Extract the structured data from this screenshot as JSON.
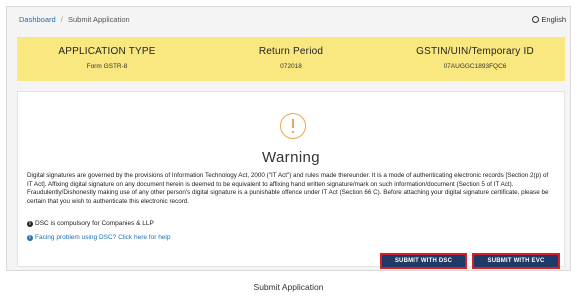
{
  "breadcrumb": {
    "home": "Dashboard",
    "separator": "/",
    "current": "Submit Application"
  },
  "language": {
    "label": "English",
    "icon": "globe-icon"
  },
  "info": {
    "application_type": {
      "label": "APPLICATION TYPE",
      "value": "Form GSTR-8"
    },
    "return_period": {
      "label": "Return Period",
      "value": "072018"
    },
    "gstin": {
      "label": "GSTIN/UIN/Temporary ID",
      "value": "07AUGGC1893FQC6"
    }
  },
  "warning": {
    "icon": "exclamation-circle-icon",
    "title": "Warning",
    "body": "Digital signatures are governed by the provisions of Information Technology Act, 2000 (\"IT Act\") and rules made thereunder. It is a mode of authenticating electronic records [Section 2(p) of IT Act]. Affixing digital signature on any document herein is deemed to be equivalent to affixing hand written signature/mark on such information/document (Section 5 of IT Act). Fraudulently/Dishonestly making use of any other person's digital signature is a punishable offence under IT Act (Section 66 C). Before attaching your digital signature certificate, please be certain that you wish to authenticate this electronic record.",
    "note_dsc": "DSC is compulsory for Companies & LLP",
    "help_link": "Facing problem using DSC? Click here for help"
  },
  "buttons": {
    "submit_dsc": "SUBMIT WITH DSC",
    "submit_evc": "SUBMIT WITH EVC"
  },
  "caption": "Submit Application",
  "colors": {
    "banner": "#f9e87f",
    "button": "#1f3a66",
    "highlight_border": "#d62027",
    "link": "#1f6fb5",
    "warning_icon": "#e8a94f"
  }
}
